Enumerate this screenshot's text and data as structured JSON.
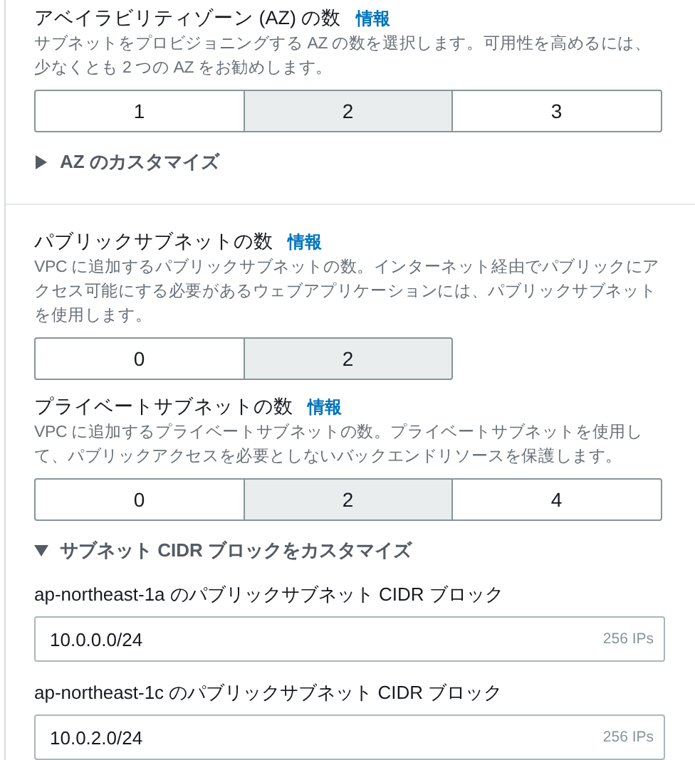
{
  "availability_zones": {
    "title": "アベイラビリティゾーン (AZ) の数",
    "info": "情報",
    "description": "サブネットをプロビジョニングする AZ の数を選択します。可用性を高めるには、少なくとも 2 つの AZ をお勧めします。",
    "options": [
      {
        "label": "1",
        "selected": false
      },
      {
        "label": "2",
        "selected": true
      },
      {
        "label": "3",
        "selected": false
      }
    ],
    "expander": {
      "label": "AZ のカスタマイズ",
      "expanded": false
    }
  },
  "public_subnets": {
    "title": "パブリックサブネットの数",
    "info": "情報",
    "description": "VPC に追加するパブリックサブネットの数。インターネット経由でパブリックにアクセス可能にする必要があるウェブアプリケーションには、パブリックサブネットを使用します。",
    "options": [
      {
        "label": "0",
        "selected": false
      },
      {
        "label": "2",
        "selected": true
      }
    ]
  },
  "private_subnets": {
    "title": "プライベートサブネットの数",
    "info": "情報",
    "description": "VPC に追加するプライベートサブネットの数。プライベートサブネットを使用して、パブリックアクセスを必要としないバックエンドリソースを保護します。",
    "options": [
      {
        "label": "0",
        "selected": false
      },
      {
        "label": "2",
        "selected": true
      },
      {
        "label": "4",
        "selected": false
      }
    ]
  },
  "cidr_customize": {
    "label": "サブネット CIDR ブロックをカスタマイズ",
    "expanded": true,
    "fields": [
      {
        "label": "ap-northeast-1a のパブリックサブネット CIDR ブロック",
        "value": "10.0.0.0/24",
        "hint": "256 IPs"
      },
      {
        "label": "ap-northeast-1c のパブリックサブネット CIDR ブロック",
        "value": "10.0.2.0/24",
        "hint": "256 IPs"
      }
    ]
  }
}
